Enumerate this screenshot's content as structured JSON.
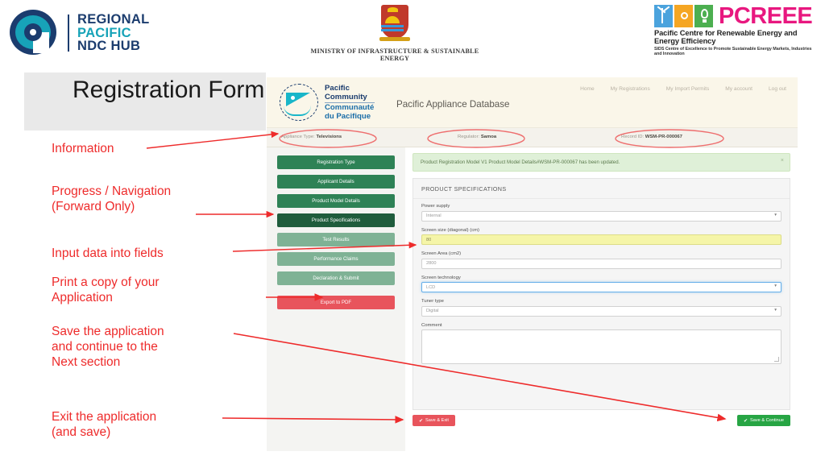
{
  "header_logos": {
    "regional_hub": {
      "line1": "REGIONAL",
      "line2": "PACIFIC",
      "line3": "NDC HUB",
      "icon": "concentric-circle-logo"
    },
    "ministry": {
      "caption": "MINISTRY OF INFRASTRUCTURE & SUSTAINABLE ENERGY",
      "icon": "kiribati-coat-of-arms"
    },
    "pcreee": {
      "wordmark": "PCREEE",
      "subtitle": "Pacific Centre for Renewable Energy and Energy Efficiency",
      "tagline": "SIDS Centre of Excellence to Promote Sustainable Energy Markets, Industries and Innovation",
      "accent_color": "#e8187f"
    }
  },
  "slide": {
    "title": "Registration\nForm"
  },
  "app": {
    "brand": {
      "line1": "Pacific",
      "line2": "Community",
      "line3": "Communauté",
      "line4": "du Pacifique",
      "icon": "spc-canoe-logo"
    },
    "app_name": "Pacific Appliance Database",
    "nav": [
      {
        "label": "Home"
      },
      {
        "label": "My Registrations"
      },
      {
        "label": "My Import Permits"
      },
      {
        "label": "My account"
      },
      {
        "label": "Log out"
      }
    ],
    "info_bar": [
      {
        "label": "Appliance Type:",
        "value": "Televisions"
      },
      {
        "label": "Regulator:",
        "value": "Samoa"
      },
      {
        "label": "Record ID:",
        "value": "WSM-PR-000067"
      }
    ],
    "sidebar": [
      {
        "label": "Registration Type"
      },
      {
        "label": "Applicant Details"
      },
      {
        "label": "Product Model Details"
      },
      {
        "label": "Product Specifications"
      },
      {
        "label": "Test Results"
      },
      {
        "label": "Performance Claims"
      },
      {
        "label": "Declaration & Submit"
      },
      {
        "label": "Export to PDF"
      }
    ],
    "alert": {
      "message": "Product Registration Model V1 Product Model Details#WSM-PR-000067 has been updated.",
      "close": "×"
    },
    "panel": {
      "heading": "PRODUCT SPECIFICATIONS",
      "fields": [
        {
          "label": "Power supply",
          "value": "Internal",
          "type": "select"
        },
        {
          "label": "Screen size (diagonal) (cm)",
          "value": "80",
          "type": "text"
        },
        {
          "label": "Screen Area (cm2)",
          "value": "2800",
          "type": "text"
        },
        {
          "label": "Screen technology",
          "value": "LCD",
          "type": "select"
        },
        {
          "label": "Tuner type",
          "value": "Digital",
          "type": "select"
        },
        {
          "label": "Comment",
          "value": "",
          "type": "textarea"
        }
      ]
    },
    "buttons": {
      "save_exit": "Save & Exit",
      "save_continue": "Save & Continue",
      "check_icon": "✔"
    }
  },
  "annotations": [
    {
      "text": "Information"
    },
    {
      "text": "Progress / Navigation\n(Forward Only)"
    },
    {
      "text": "Input data into fields"
    },
    {
      "text": "Print a copy of your\nApplication"
    },
    {
      "text": "Save the application\nand continue to the\nNext section"
    },
    {
      "text": "Exit the application\n(and save)"
    }
  ],
  "colors": {
    "annotation": "#ee2b2b",
    "primary_green": "#2e8256",
    "active_green": "#1f5c3c",
    "danger": "#e8545c"
  }
}
